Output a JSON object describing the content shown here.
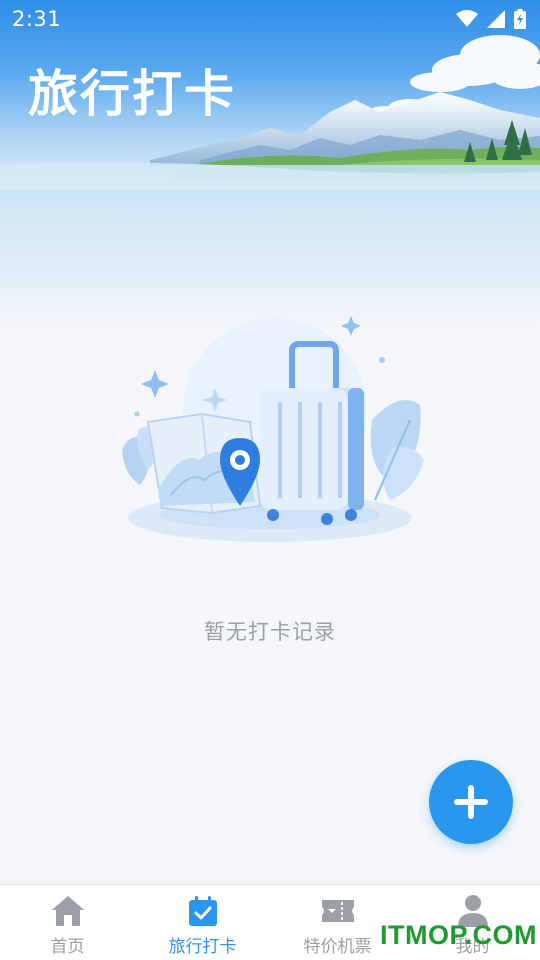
{
  "status_bar": {
    "time": "2:31"
  },
  "header": {
    "title": "旅行打卡"
  },
  "empty_state": {
    "message": "暂无打卡记录"
  },
  "fab": {
    "icon": "plus-icon"
  },
  "tabs": [
    {
      "label": "首页",
      "icon": "home-icon",
      "active": false
    },
    {
      "label": "旅行打卡",
      "icon": "calendar-check-icon",
      "active": true
    },
    {
      "label": "特价机票",
      "icon": "ticket-icon",
      "active": false
    },
    {
      "label": "我的",
      "icon": "person-icon",
      "active": false
    }
  ],
  "watermark": "ITMOP.COM",
  "colors": {
    "accent": "#2a97ef",
    "inactive": "#9a9fa8",
    "background": "#f4f6fa"
  }
}
